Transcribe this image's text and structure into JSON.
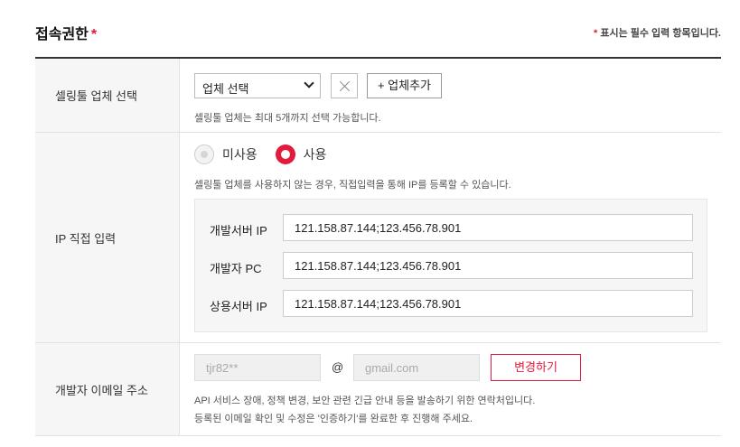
{
  "header": {
    "title": "접속권한",
    "required_star": "*",
    "required_note": "표시는 필수 입력 항목입니다.",
    "note_star": "*"
  },
  "colors": {
    "accent": "#e21a3d",
    "label_bg": "#f6f6f6"
  },
  "vendor": {
    "label": "셀링툴 업체 선택",
    "select_value": "업체 선택",
    "clear_icon": "close-icon",
    "add_button": "+ 업체추가",
    "help": "셀링툴 업체는 최대 5개까지 선택 가능합니다."
  },
  "ip": {
    "label": "IP 직접 입력",
    "radio_off": "미사용",
    "radio_on": "사용",
    "selected": "사용",
    "help": "셀링툴 업체를 사용하지 않는 경우, 직접입력을 통해 IP를 등록할 수 있습니다.",
    "rows": [
      {
        "label": "개발서버 IP",
        "value": "121.158.87.144;123.456.78.901"
      },
      {
        "label": "개발자 PC",
        "value": "121.158.87.144;123.456.78.901"
      },
      {
        "label": "상용서버 IP",
        "value": "121.158.87.144;123.456.78.901"
      }
    ]
  },
  "email": {
    "label": "개발자 이메일 주소",
    "id_value": "tjr82**",
    "at": "@",
    "domain_value": "gmail.com",
    "change_button": "변경하기",
    "help_line1": "API 서비스 장애, 정책 변경, 보안 관련 긴급 안내 등을 발송하기 위한 연락처입니다.",
    "help_line2": "등록된 이메일 확인 및 수정은 '인증하기'를 완료한 후 진행해 주세요."
  }
}
